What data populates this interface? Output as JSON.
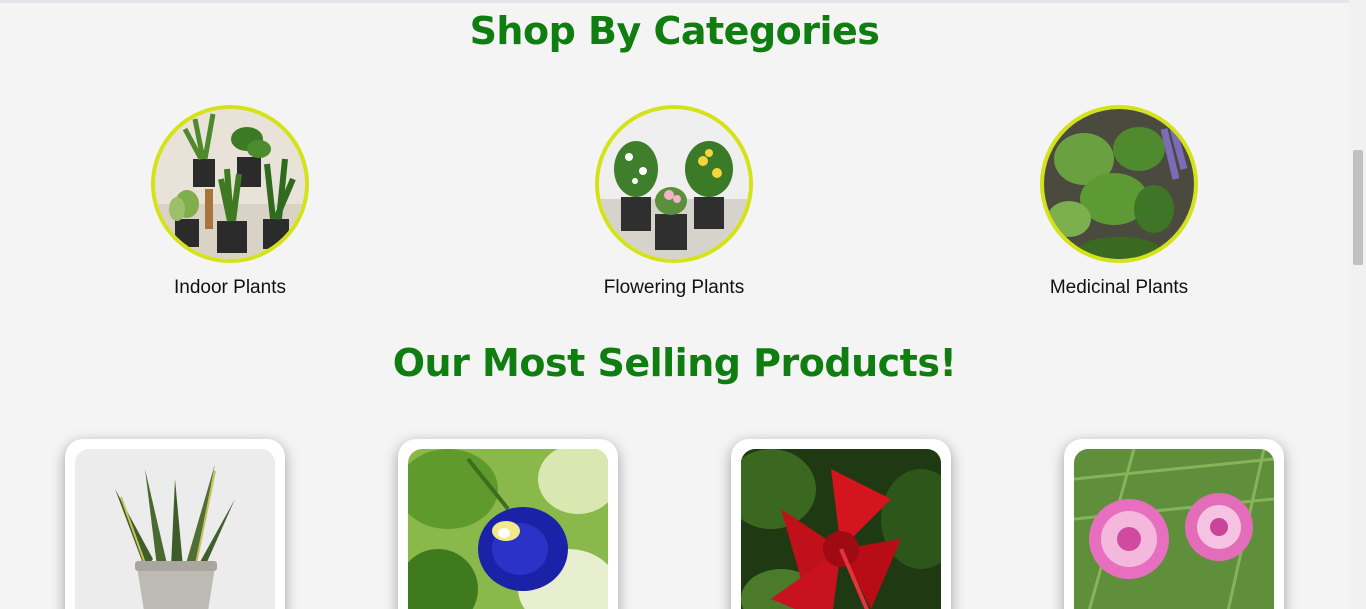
{
  "sections": {
    "categories_title": "Shop By Categories",
    "best_selling_title": "Our Most Selling Products!"
  },
  "categories": [
    {
      "label": "Indoor Plants",
      "image": "indoor-plants-photo"
    },
    {
      "label": "Flowering Plants",
      "image": "flowering-plants-photo"
    },
    {
      "label": "Medicinal Plants",
      "image": "medicinal-plants-photo"
    }
  ],
  "products": [
    {
      "image": "snake-plant-photo"
    },
    {
      "image": "butterfly-pea-flower-photo"
    },
    {
      "image": "red-hibiscus-photo"
    },
    {
      "image": "pink-portulaca-photo"
    }
  ],
  "colors": {
    "heading": "#0f7d0f",
    "circle_border": "#d4e218",
    "background": "#f4f4f4"
  }
}
